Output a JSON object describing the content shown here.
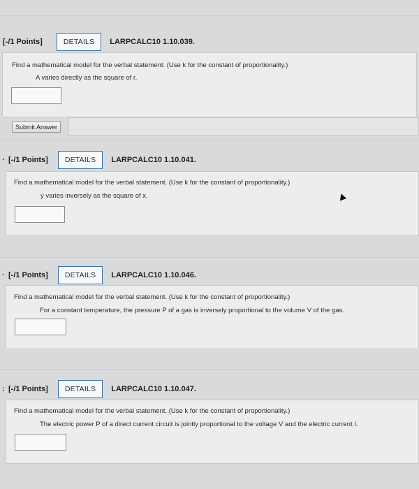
{
  "questions": [
    {
      "bullet": "",
      "points": "[-/1 Points]",
      "details_label": "DETAILS",
      "code": "LARPCALC10 1.10.039.",
      "prompt": "Find a mathematical model for the verbal statement. (Use k for the constant of proportionality.)",
      "statement": "A varies directly as the square of r.",
      "answer_value": "",
      "submit_label": "Submit Answer"
    },
    {
      "bullet": "·",
      "points": "[-/1 Points]",
      "details_label": "DETAILS",
      "code": "LARPCALC10 1.10.041.",
      "prompt": "Find a mathematical model for the verbal statement. (Use k for the constant of proportionality.)",
      "statement": "y varies inversely as the square of x.",
      "answer_value": ""
    },
    {
      "bullet": "·",
      "points": "[-/1 Points]",
      "details_label": "DETAILS",
      "code": "LARPCALC10 1.10.046.",
      "prompt": "Find a mathematical model for the verbal statement. (Use k for the constant of proportionality.)",
      "statement": "For a constant temperature, the pressure P of a gas is inversely proportional to the volume V of the gas.",
      "answer_value": ""
    },
    {
      "bullet": ":",
      "points": "[-/1 Points]",
      "details_label": "DETAILS",
      "code": "LARPCALC10 1.10.047.",
      "prompt": "Find a mathematical model for the verbal statement. (Use k for the constant of proportionality.)",
      "statement": "The electric power P of a direct current circuit is jointly proportional to the voltage V and the electric current I.",
      "answer_value": ""
    }
  ],
  "colors": {
    "background": "#d9dadc",
    "panel": "#eceded",
    "details_border": "#3d6fa5"
  },
  "icons": {
    "cursor": "mouse-pointer-icon"
  }
}
